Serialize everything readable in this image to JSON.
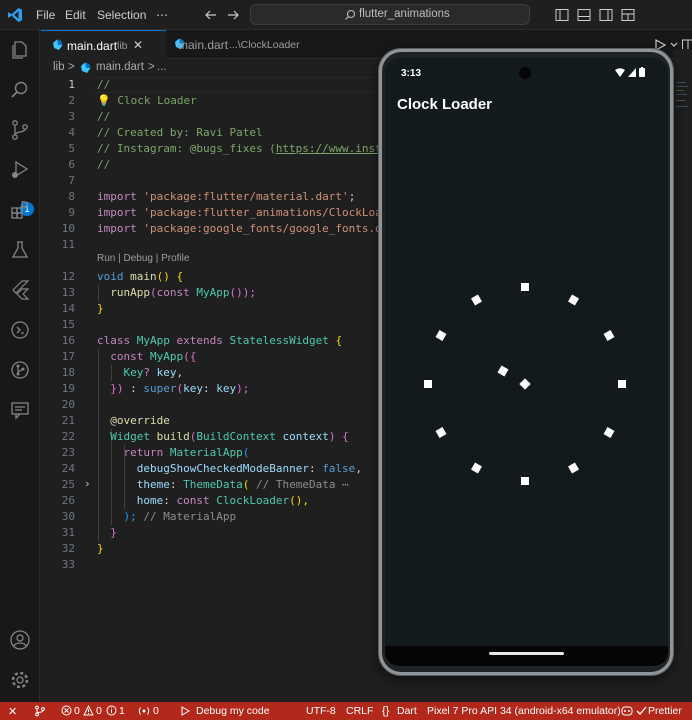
{
  "titlebar": {
    "menu": [
      "File",
      "Edit",
      "Selection",
      "⋯"
    ],
    "search_text": "flutter_animations"
  },
  "activitybar": {
    "icons": [
      "explorer-icon",
      "search-icon",
      "source-control-icon",
      "run-debug-icon",
      "extensions-icon",
      "testing-icon",
      "flutter-icon",
      "remote-icon",
      "git-graph-icon",
      "comments-icon"
    ],
    "debug_badge": "1",
    "bottom_icons": [
      "account-icon",
      "settings-gear-icon"
    ]
  },
  "tabs": [
    {
      "name": "main.dart",
      "description": "lib",
      "active": true
    },
    {
      "name": "main.dart",
      "description": "...\\ClockLoader",
      "active": false
    }
  ],
  "breadcrumb": {
    "folder": "lib",
    "sep": ">",
    "file": "main.dart",
    "more": "..."
  },
  "editor": {
    "codelens": "Run | Debug | Profile",
    "lines": {
      "l1": "//",
      "l2": "Clock Loader",
      "l3": "//",
      "l4": "// Created by: Ravi Patel",
      "l5a": "// Instagram: @bugs_fixes (",
      "l5b": "https://www.insta",
      "l6": "//",
      "l8a": "import",
      "l8b": "'package:flutter/material.dart'",
      "l8c": ";",
      "l9a": "import",
      "l9b": "'package:flutter_animations/ClockLoad",
      "l10a": "import",
      "l10b": "'package:google_fonts/google_fonts.da",
      "l12a": "void",
      "l12b": "main",
      "l12c": "() {",
      "l13a": "runApp",
      "l13b": "(",
      "l13c": "const",
      "l13d": "MyApp",
      "l13e": "());",
      "l14": "}",
      "l16a": "class",
      "l16b": "MyApp",
      "l16c": "extends",
      "l16d": "StatelessWidget",
      "l16e": "{",
      "l17a": "const",
      "l17b": "MyApp",
      "l17c": "({",
      "l18a": "Key",
      "l18b": "?",
      "l18c": "key",
      "l18d": ",",
      "l19a": "})",
      "l19b": " : ",
      "l19c": "super",
      "l19d": "(",
      "l19e": "key",
      "l19f": ": ",
      "l19g": "key",
      "l19h": ");",
      "l21": "@override",
      "l22a": "Widget",
      "l22b": "build",
      "l22c": "(",
      "l22d": "BuildContext",
      "l22e": "context",
      "l22f": ") {",
      "l23a": "return",
      "l23b": "MaterialApp",
      "l23c": "(",
      "l24a": "debugShowCheckedModeBanner",
      "l24b": ": ",
      "l24c": "false",
      "l24d": ",",
      "l25a": "theme",
      "l25b": ": ",
      "l25c": "ThemeData",
      "l25d": "( ",
      "l25e": "// ThemeData",
      "l25f": " ⋯",
      "l26a": "home",
      "l26b": ": ",
      "l26c": "const",
      "l26d": "ClockLoader",
      "l26e": "(),",
      "l27a": ");",
      "l27b": " // MaterialApp",
      "l28": "}",
      "l29": "}"
    },
    "line_numbers": {
      "n1": "1",
      "n2": "2",
      "n3": "3",
      "n4": "4",
      "n5": "5",
      "n6": "6",
      "n7": "7",
      "n8": "8",
      "n9": "9",
      "n10": "10",
      "n11": "11",
      "n12": "12",
      "n13": "13",
      "n14": "14",
      "n15": "15",
      "n16": "16",
      "n17": "17",
      "n18": "18",
      "n19": "19",
      "n20": "20",
      "n21": "21",
      "n22": "22",
      "n23": "23",
      "n24": "24",
      "n25": "25",
      "n26": "26",
      "n30": "30",
      "n31": "31",
      "n32": "32",
      "n33": "33"
    }
  },
  "phone": {
    "time": "3:13",
    "app_title": "Clock Loader",
    "device": "Pixel 7 Pro API 34 (android-x64 emulator)"
  },
  "statusbar": {
    "remote": "✕",
    "branch_icon": "git-branch-icon",
    "errors": "0",
    "warnings": "0",
    "info": "1",
    "ports": "0",
    "debug": "Debug my code",
    "encoding": "UTF-8",
    "eol": "CRLF",
    "language": "Dart",
    "device": "Pixel 7 Pro API 34 (android-x64 emulator)",
    "prettier": "Prettier"
  },
  "colors": {
    "statusbar": "#b2281b",
    "accent": "#0078d4",
    "editor_bg": "#1f1f1f",
    "phone_bg": "#121a1e"
  }
}
